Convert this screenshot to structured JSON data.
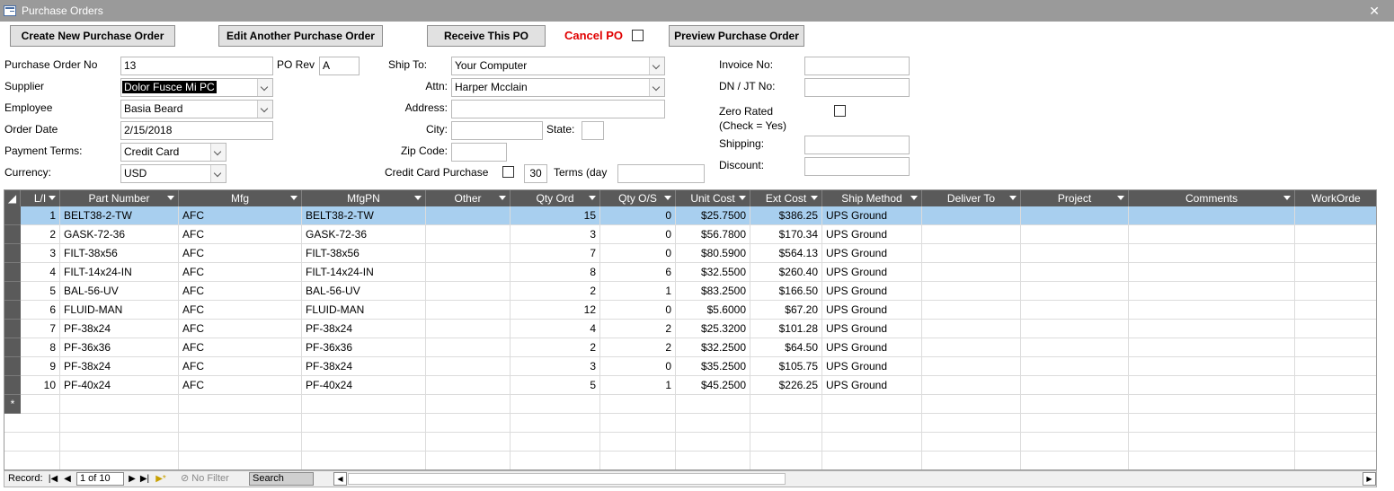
{
  "window": {
    "title": "Purchase Orders",
    "close_glyph": "✕"
  },
  "toolbar": {
    "create_new": "Create New Purchase Order",
    "edit_another": "Edit Another Purchase Order",
    "receive": "Receive This PO",
    "cancel_label": "Cancel PO",
    "preview": "Preview Purchase Order"
  },
  "form": {
    "po_no_label": "Purchase Order No",
    "po_no": "13",
    "po_rev_label": "PO Rev",
    "po_rev": "A",
    "supplier_label": "Supplier",
    "supplier": "Dolor Fusce Mi PC",
    "employee_label": "Employee",
    "employee": "Basia Beard",
    "order_date_label": "Order Date",
    "order_date": "2/15/2018",
    "payment_terms_label": "Payment Terms:",
    "payment_terms": "Credit Card",
    "currency_label": "Currency:",
    "currency": "USD",
    "ship_to_label": "Ship To:",
    "ship_to": "Your Computer",
    "attn_label": "Attn:",
    "attn": "Harper Mcclain",
    "address_label": "Address:",
    "address": "",
    "city_label": "City:",
    "city": "",
    "state_label": "State:",
    "state": "",
    "zip_label": "Zip Code:",
    "zip": "",
    "cc_purchase_label": "Credit Card Purchase",
    "terms_days_value": "30",
    "terms_label": "Terms (day",
    "terms_value": "",
    "invoice_label": "Invoice No:",
    "invoice": "",
    "dn_label": "DN / JT No:",
    "dn": "",
    "zero_rated_label": "Zero Rated",
    "zero_rated_hint": "(Check = Yes)",
    "shipping_label": "Shipping:",
    "shipping": "",
    "discount_label": "Discount:",
    "discount": ""
  },
  "grid": {
    "columns": [
      "L/I",
      "Part Number",
      "Mfg",
      "MfgPN",
      "Other",
      "Qty Ord",
      "Qty O/S",
      "Unit Cost",
      "Ext Cost",
      "Ship Method",
      "Deliver To",
      "Project",
      "Comments",
      "WorkOrde"
    ],
    "rows": [
      [
        "1",
        "BELT38-2-TW",
        "AFC",
        "BELT38-2-TW",
        "",
        "15",
        "0",
        "$25.7500",
        "$386.25",
        "UPS Ground",
        "",
        "",
        "",
        ""
      ],
      [
        "2",
        "GASK-72-36",
        "AFC",
        "GASK-72-36",
        "",
        "3",
        "0",
        "$56.7800",
        "$170.34",
        "UPS Ground",
        "",
        "",
        "",
        ""
      ],
      [
        "3",
        "FILT-38x56",
        "AFC",
        "FILT-38x56",
        "",
        "7",
        "0",
        "$80.5900",
        "$564.13",
        "UPS Ground",
        "",
        "",
        "",
        ""
      ],
      [
        "4",
        "FILT-14x24-IN",
        "AFC",
        "FILT-14x24-IN",
        "",
        "8",
        "6",
        "$32.5500",
        "$260.40",
        "UPS Ground",
        "",
        "",
        "",
        ""
      ],
      [
        "5",
        "BAL-56-UV",
        "AFC",
        "BAL-56-UV",
        "",
        "2",
        "1",
        "$83.2500",
        "$166.50",
        "UPS Ground",
        "",
        "",
        "",
        ""
      ],
      [
        "6",
        "FLUID-MAN",
        "AFC",
        "FLUID-MAN",
        "",
        "12",
        "0",
        "$5.6000",
        "$67.20",
        "UPS Ground",
        "",
        "",
        "",
        ""
      ],
      [
        "7",
        "PF-38x24",
        "AFC",
        "PF-38x24",
        "",
        "4",
        "2",
        "$25.3200",
        "$101.28",
        "UPS Ground",
        "",
        "",
        "",
        ""
      ],
      [
        "8",
        "PF-36x36",
        "AFC",
        "PF-36x36",
        "",
        "2",
        "2",
        "$32.2500",
        "$64.50",
        "UPS Ground",
        "",
        "",
        "",
        ""
      ],
      [
        "9",
        "PF-38x24",
        "AFC",
        "PF-38x24",
        "",
        "3",
        "0",
        "$35.2500",
        "$105.75",
        "UPS Ground",
        "",
        "",
        "",
        ""
      ],
      [
        "10",
        "PF-40x24",
        "AFC",
        "PF-40x24",
        "",
        "5",
        "1",
        "$45.2500",
        "$226.25",
        "UPS Ground",
        "",
        "",
        "",
        ""
      ]
    ],
    "new_row_glyph": "*"
  },
  "navigator": {
    "record_label": "Record:",
    "position": "1 of 10",
    "filter": "No Filter",
    "search": "Search",
    "first": "|◀",
    "prev": "◀",
    "next": "▶",
    "last": "▶|",
    "new": "▶*"
  }
}
